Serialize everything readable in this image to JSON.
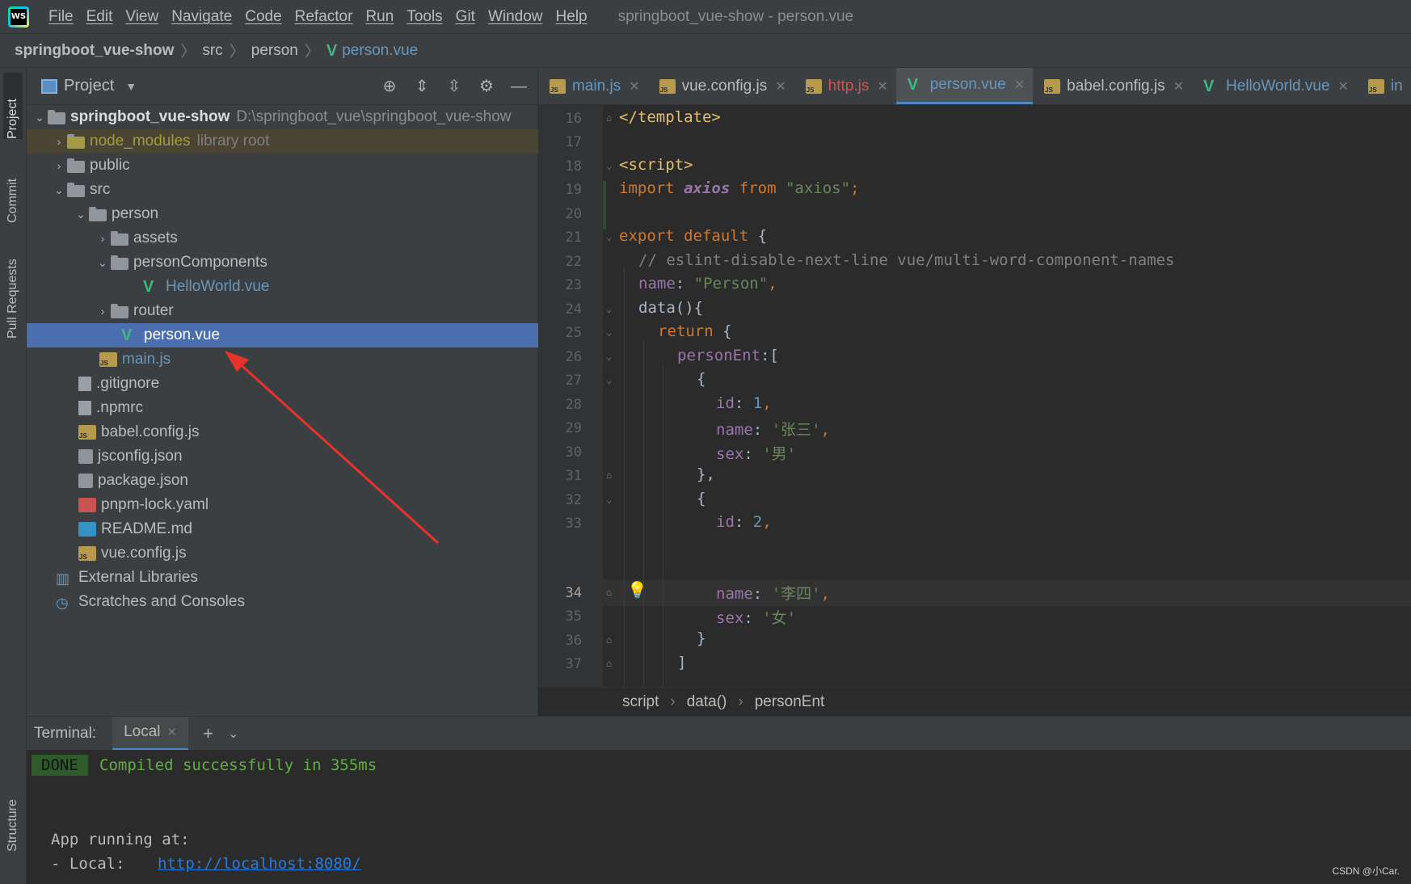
{
  "menubar": {
    "items": [
      "File",
      "Edit",
      "View",
      "Navigate",
      "Code",
      "Refactor",
      "Run",
      "Tools",
      "Git",
      "Window",
      "Help"
    ],
    "window_title": "springboot_vue-show - person.vue"
  },
  "breadcrumb": {
    "project": "springboot_vue-show",
    "folder1": "src",
    "folder2": "person",
    "file": "person.vue"
  },
  "toolstrip": {
    "project": "Project",
    "commit": "Commit",
    "pull_requests": "Pull Requests",
    "structure": "Structure"
  },
  "project_panel": {
    "title": "Project",
    "tree": {
      "root_name": "springboot_vue-show",
      "root_path": "D:\\springboot_vue\\springboot_vue-show",
      "node_modules": "node_modules",
      "node_modules_note": "library root",
      "public": "public",
      "src": "src",
      "person": "person",
      "assets": "assets",
      "personComponents": "personComponents",
      "helloworld": "HelloWorld.vue",
      "router": "router",
      "person_vue": "person.vue",
      "main_js": "main.js",
      "gitignore": ".gitignore",
      "npmrc": ".npmrc",
      "babel": "babel.config.js",
      "jsconfig": "jsconfig.json",
      "package": "package.json",
      "pnpm": "pnpm-lock.yaml",
      "readme": "README.md",
      "vueconfig": "vue.config.js",
      "external": "External Libraries",
      "scratches": "Scratches and Consoles"
    }
  },
  "tabs": {
    "main": "main.js",
    "vueconfig": "vue.config.js",
    "http": "http.js",
    "person": "person.vue",
    "babel": "babel.config.js",
    "hello": "HelloWorld.vue",
    "partial": "in"
  },
  "editor": {
    "current_line": 34,
    "line_numbers": [
      "16",
      "17",
      "18",
      "19",
      "20",
      "21",
      "22",
      "23",
      "24",
      "25",
      "26",
      "27",
      "28",
      "29",
      "30",
      "31",
      "32",
      "33",
      "34",
      "35",
      "36",
      "37"
    ],
    "code": {
      "l16": "</template>",
      "l18": "<script>",
      "l19_kw1": "import",
      "l19_id": "axios",
      "l19_kw2": "from",
      "l19_str": "\"axios\"",
      "l19_end": ";",
      "l21_kw1": "export",
      "l21_kw2": "default",
      "l21_end": " {",
      "l22": "// eslint-disable-next-line vue/multi-word-component-names",
      "l23_key": "name",
      "l23_colon": ": ",
      "l23_val": "\"Person\"",
      "l23_end": ",",
      "l24": "data(){",
      "l25_kw": "return",
      "l25_end": " {",
      "l26_key": "personEnt",
      "l26_end": ":[",
      "l27": "{",
      "l28_key": "id",
      "l28_colon": ": ",
      "l28_val": "1",
      "l28_end": ",",
      "l29_key": "name",
      "l29_colon": ": ",
      "l29_val": "'张三'",
      "l29_end": ",",
      "l30_key": "sex",
      "l30_colon": ": ",
      "l30_val": "'男'",
      "l31": "},",
      "l32": "{",
      "l33_key": "id",
      "l33_colon": ": ",
      "l33_val": "2",
      "l33_end": ",",
      "l34_key": "name",
      "l34_colon": ": ",
      "l34_val": "'李四'",
      "l34_end": ",",
      "l35_key": "sex",
      "l35_colon": ": ",
      "l35_val": "'女'",
      "l36": "}",
      "l37": "]"
    },
    "breadcrumb": {
      "a": "script",
      "b": "data()",
      "c": "personEnt"
    }
  },
  "terminal": {
    "label": "Terminal:",
    "tab": "Local",
    "done_badge": "DONE",
    "compiled": "Compiled successfully in 355ms",
    "app_running": "App running at:",
    "local_label": "- Local:   ",
    "local_url": "http://localhost:8080/"
  },
  "watermark": "CSDN @小Car.",
  "colors": {
    "selection": "#4b6eaf",
    "tab_accent": "#4a88c7",
    "arrow": "#e8322c",
    "vue_green": "#41b883"
  }
}
